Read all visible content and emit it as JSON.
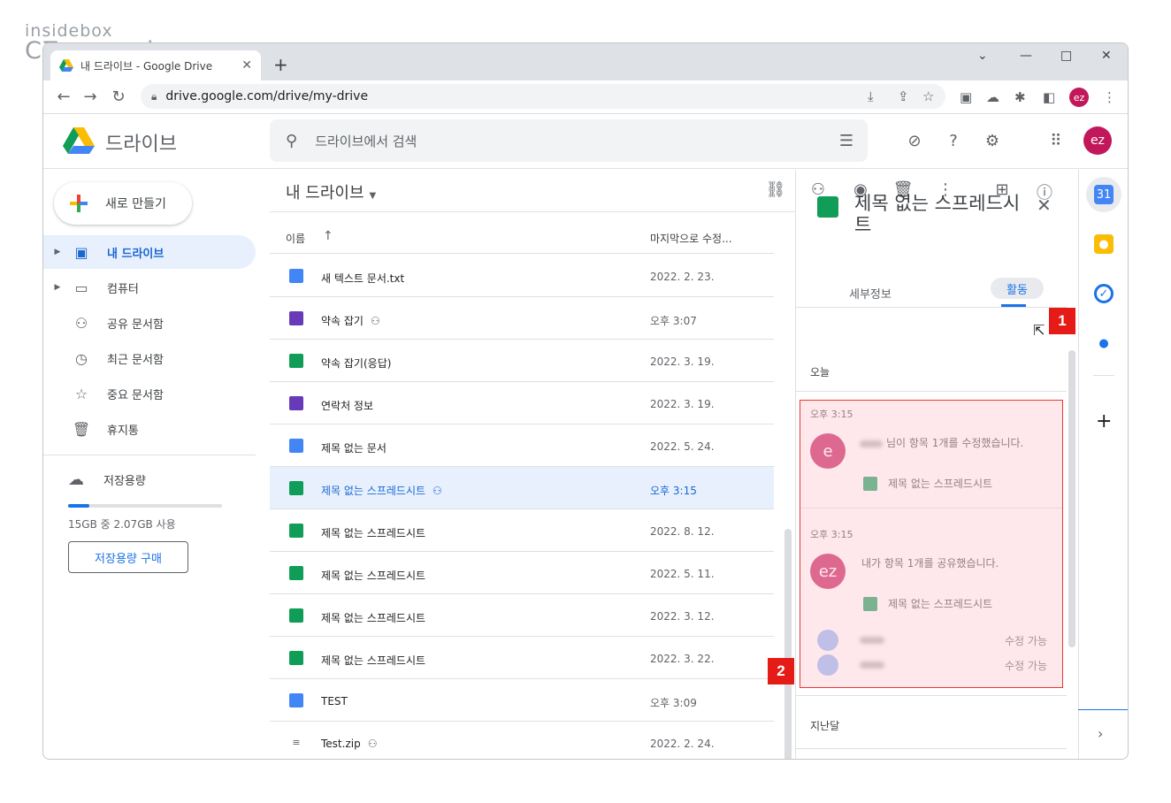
{
  "watermark": {
    "line1": "insidebox",
    "line2": "CZmanual"
  },
  "browser": {
    "tab_title": "내 드라이브 - Google Drive",
    "tab_close": "✕",
    "new_tab": "+",
    "url": "drive.google.com/drive/my-drive",
    "profile_initials": "ez",
    "win_min": "—",
    "win_max": "□",
    "win_close": "✕",
    "win_dropdown": "⌄"
  },
  "header": {
    "brand": "드라이브",
    "search_placeholder": "드라이브에서 검색",
    "avatar_initials": "ez"
  },
  "sidebar": {
    "new_button": "새로 만들기",
    "items": [
      {
        "label": "내 드라이브",
        "icon": "drive-icon",
        "active": true
      },
      {
        "label": "컴퓨터",
        "icon": "computer-icon"
      },
      {
        "label": "공유 문서함",
        "icon": "people-icon"
      },
      {
        "label": "최근 문서함",
        "icon": "clock-icon"
      },
      {
        "label": "중요 문서함",
        "icon": "star-icon"
      },
      {
        "label": "휴지통",
        "icon": "trash-icon"
      }
    ],
    "storage_label": "저장용량",
    "storage_text": "15GB 중 2.07GB 사용",
    "storage_fraction": 0.138,
    "buy_button": "저장용량 구매"
  },
  "main": {
    "breadcrumb": "내 드라이브",
    "col_name": "이름",
    "col_modified": "마지막으로 수정...",
    "files": [
      {
        "name": "새 텍스트 문서.txt",
        "date": "2022. 2. 23.",
        "type": "txt",
        "shared": false
      },
      {
        "name": "약속 잡기",
        "date": "오후 3:07",
        "type": "form",
        "shared": true
      },
      {
        "name": "약속 잡기(응답)",
        "date": "2022. 3. 19.",
        "type": "sheet",
        "shared": false
      },
      {
        "name": "연락처 정보",
        "date": "2022. 3. 19.",
        "type": "form",
        "shared": false
      },
      {
        "name": "제목 없는 문서",
        "date": "2022. 5. 24.",
        "type": "doc",
        "shared": false
      },
      {
        "name": "제목 없는 스프레드시트",
        "date": "오후 3:15",
        "type": "sheet",
        "shared": true,
        "selected": true
      },
      {
        "name": "제목 없는 스프레드시트",
        "date": "2022. 8. 12.",
        "type": "sheet",
        "shared": false
      },
      {
        "name": "제목 없는 스프레드시트",
        "date": "2022. 5. 11.",
        "type": "sheet",
        "shared": false
      },
      {
        "name": "제목 없는 스프레드시트",
        "date": "2022. 3. 12.",
        "type": "sheet",
        "shared": false
      },
      {
        "name": "제목 없는 스프레드시트",
        "date": "2022. 3. 22.",
        "type": "sheet",
        "shared": false
      },
      {
        "name": "TEST",
        "date": "오후 3:09",
        "type": "doc",
        "shared": false
      },
      {
        "name": "Test.zip",
        "date": "2022. 2. 24.",
        "type": "zip",
        "shared": true
      }
    ]
  },
  "details": {
    "title": "제목 없는 스프레드시트",
    "tab_details": "세부정보",
    "tab_activity": "활동",
    "section_today": "오늘",
    "activities": [
      {
        "time": "오후 3:15",
        "avatar": "e",
        "message": "님이 항목 1개를 수정했습니다.",
        "file": "제목 없는 스프레드시트"
      },
      {
        "time": "오후 3:15",
        "avatar": "ez",
        "message": "내가 항목 1개를 공유했습니다.",
        "file": "제목 없는 스프레드시트",
        "permissions": [
          {
            "role": "수정 가능"
          },
          {
            "role": "수정 가능"
          }
        ]
      }
    ],
    "section_last_month": "지난달"
  },
  "annotations": {
    "badge1": "1",
    "badge2": "2"
  },
  "colors": {
    "accent": "#1a73e8",
    "sheet_green": "#0f9d58",
    "form_purple": "#673ab7",
    "highlight_red": "#e41b17",
    "avatar_pink": "#c2185b"
  }
}
